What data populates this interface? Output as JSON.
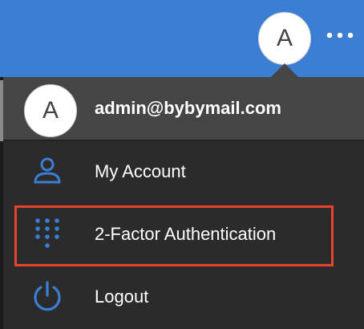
{
  "topbar": {
    "avatar_initial": "A",
    "more_icon": "more-dots-icon",
    "bg_color": "#3b7ed4"
  },
  "account_menu": {
    "avatar_initial": "A",
    "email": "admin@bybymail.com",
    "items": [
      {
        "label": "My Account",
        "icon": "user-icon"
      },
      {
        "label": "2-Factor Authentication",
        "icon": "keypad-icon",
        "highlighted": true
      },
      {
        "label": "Logout",
        "icon": "power-icon"
      }
    ],
    "icon_color": "#3b7ed4",
    "highlight_color": "#e8432e"
  }
}
